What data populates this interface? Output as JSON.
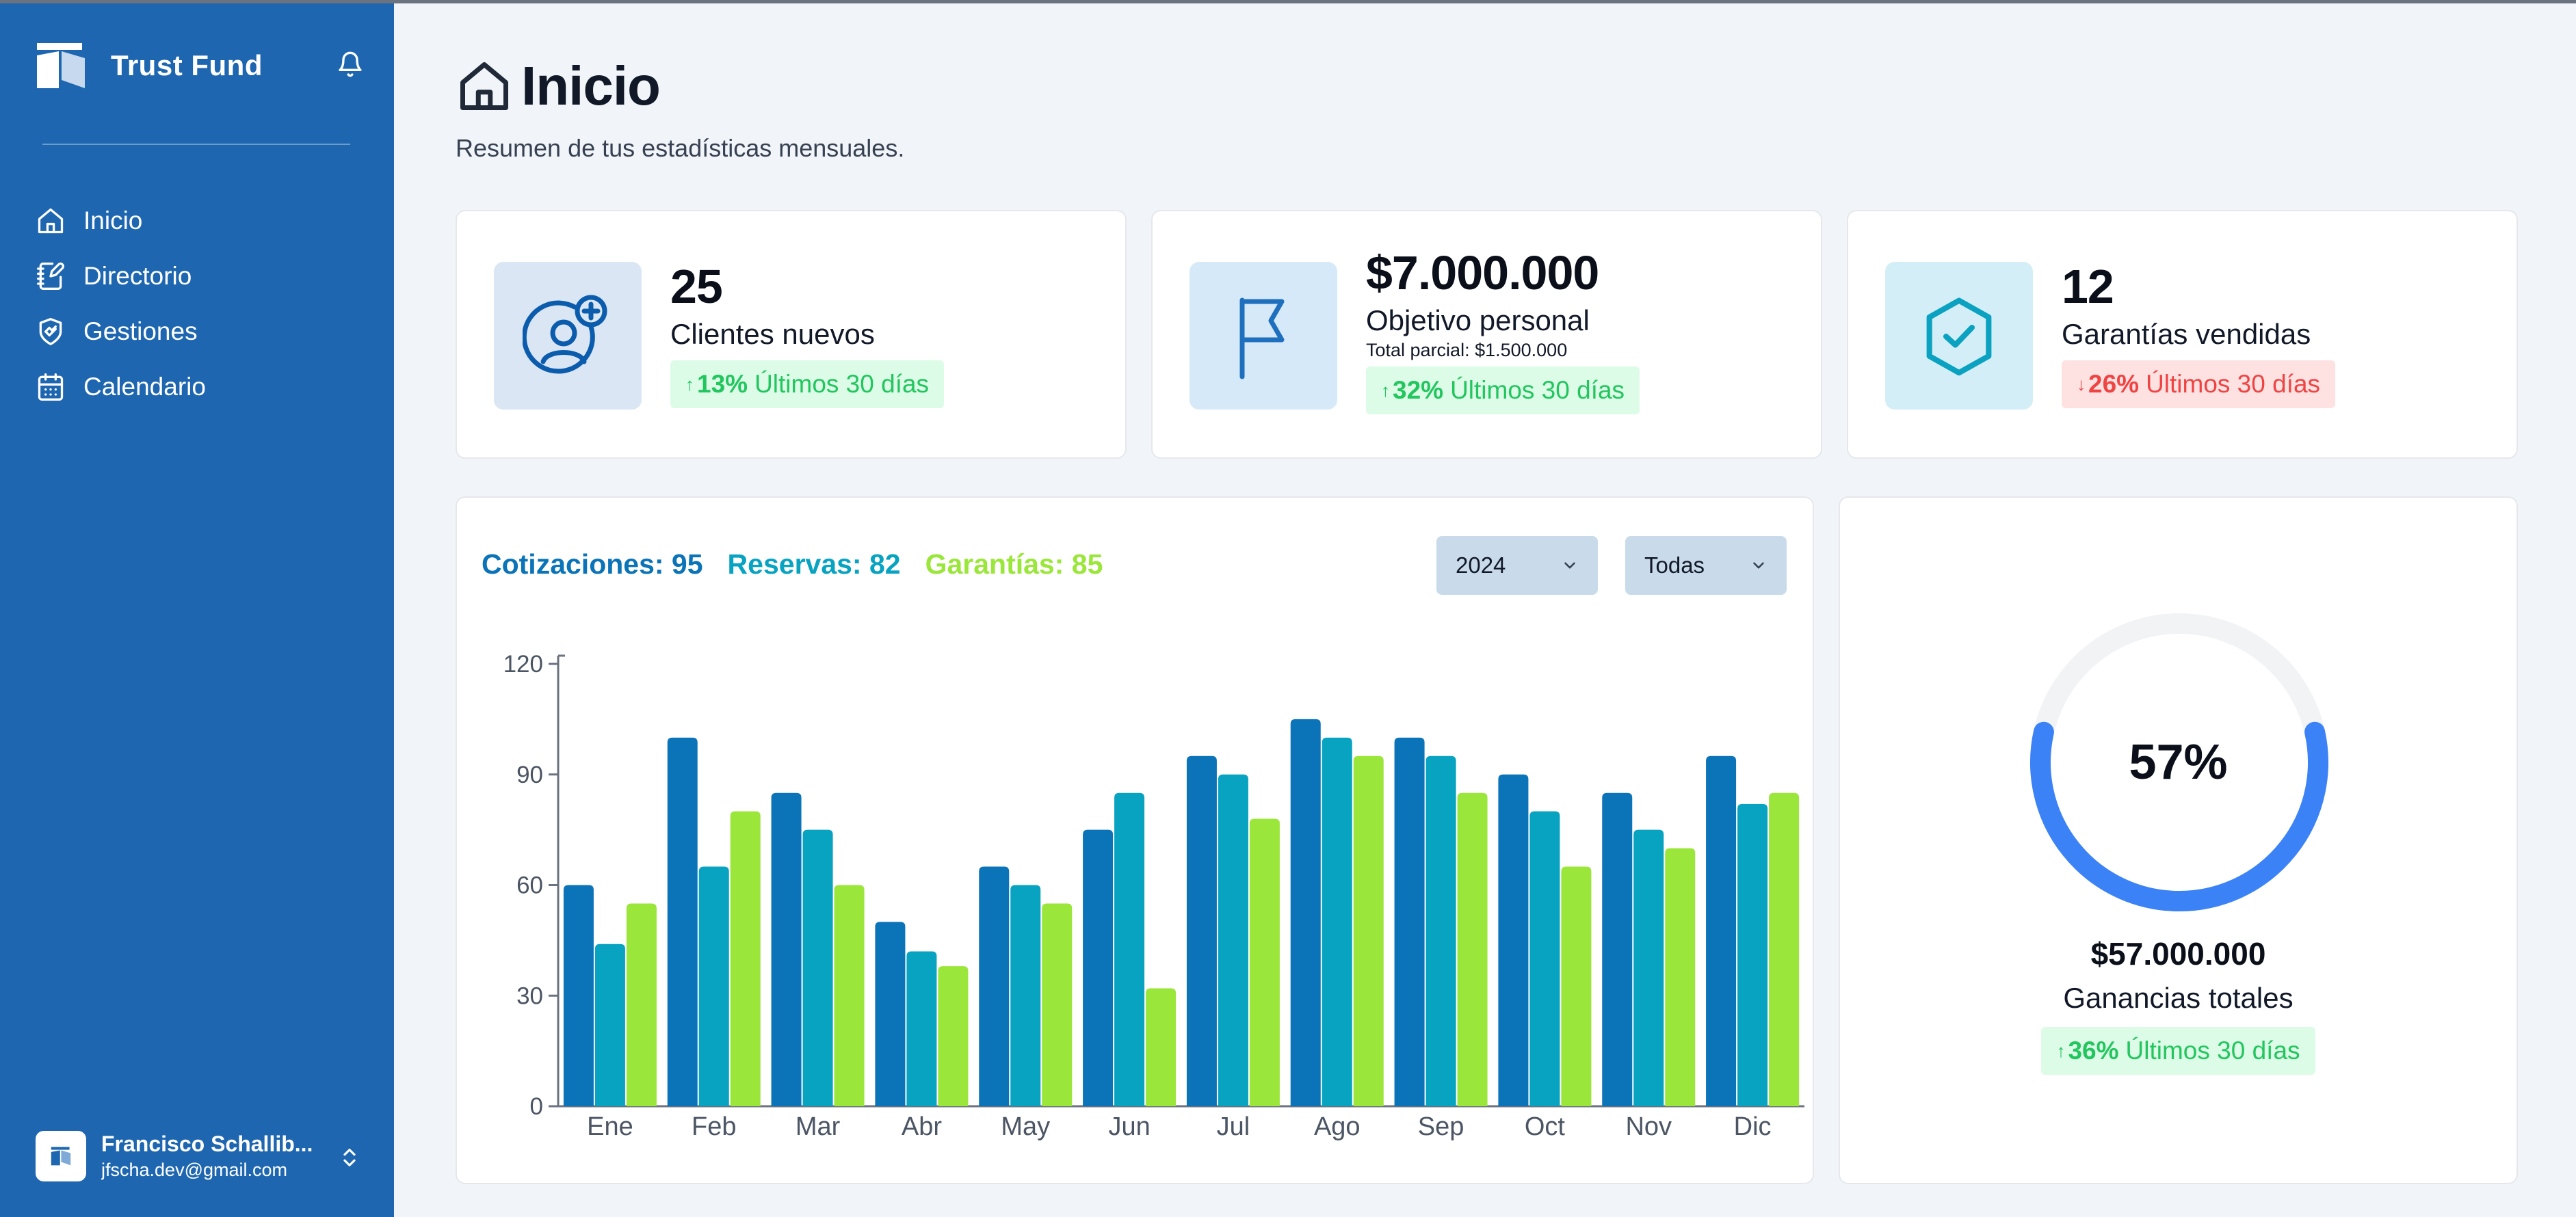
{
  "app": {
    "name": "Trust Fund"
  },
  "sidebar": {
    "items": [
      {
        "label": "Inicio",
        "icon": "home-icon"
      },
      {
        "label": "Directorio",
        "icon": "notebook-pen-icon"
      },
      {
        "label": "Gestiones",
        "icon": "shield-handshake-icon"
      },
      {
        "label": "Calendario",
        "icon": "calendar-icon"
      }
    ],
    "user": {
      "name": "Francisco Schallib...",
      "email": "jfscha.dev@gmail.com"
    }
  },
  "header": {
    "title": "Inicio",
    "subtitle": "Resumen de tus estadísticas mensuales."
  },
  "stats": [
    {
      "value": "25",
      "label": "Clientes nuevos",
      "change": "13%",
      "direction": "up",
      "period": "Últimos 30 días",
      "icon": "user-plus-icon"
    },
    {
      "value": "$7.000.000",
      "label": "Objetivo personal",
      "sub": "Total parcial: $1.500.000",
      "change": "32%",
      "direction": "up",
      "period": "Últimos 30 días",
      "icon": "flag-icon"
    },
    {
      "value": "12",
      "label": "Garantías vendidas",
      "change": "26%",
      "direction": "down",
      "period": "Últimos 30 días",
      "icon": "shield-check-icon"
    }
  ],
  "chart_summary": {
    "cotizaciones": "Cotizaciones: 95",
    "reservas": "Reservas: 82",
    "garantias": "Garantías: 85"
  },
  "filters": {
    "year": "2024",
    "category": "Todas"
  },
  "chart_data": {
    "type": "bar",
    "categories": [
      "Ene",
      "Feb",
      "Mar",
      "Abr",
      "May",
      "Jun",
      "Jul",
      "Ago",
      "Sep",
      "Oct",
      "Nov",
      "Dic"
    ],
    "series": [
      {
        "name": "Cotizaciones",
        "color": "#0b73b7",
        "values": [
          60,
          100,
          85,
          50,
          65,
          75,
          95,
          105,
          100,
          90,
          85,
          95
        ]
      },
      {
        "name": "Reservas",
        "color": "#07a3c1",
        "values": [
          44,
          65,
          75,
          42,
          60,
          85,
          90,
          100,
          95,
          80,
          75,
          82
        ]
      },
      {
        "name": "Garantías",
        "color": "#9be63a",
        "values": [
          55,
          80,
          60,
          38,
          55,
          32,
          78,
          95,
          85,
          65,
          70,
          85
        ]
      }
    ],
    "ylim": [
      0,
      120
    ],
    "yticks": [
      0,
      30,
      60,
      90,
      120
    ],
    "grid": false
  },
  "earnings": {
    "percent": "57%",
    "progress": 0.57,
    "amount": "$57.000.000",
    "label": "Ganancias totales",
    "change": "36%",
    "direction": "up",
    "period": "Últimos 30 días"
  },
  "colors": {
    "sidebar": "#1e67b0",
    "accent_blue": "#3b82f6",
    "positive": "#22c55e",
    "negative": "#ef4444"
  }
}
